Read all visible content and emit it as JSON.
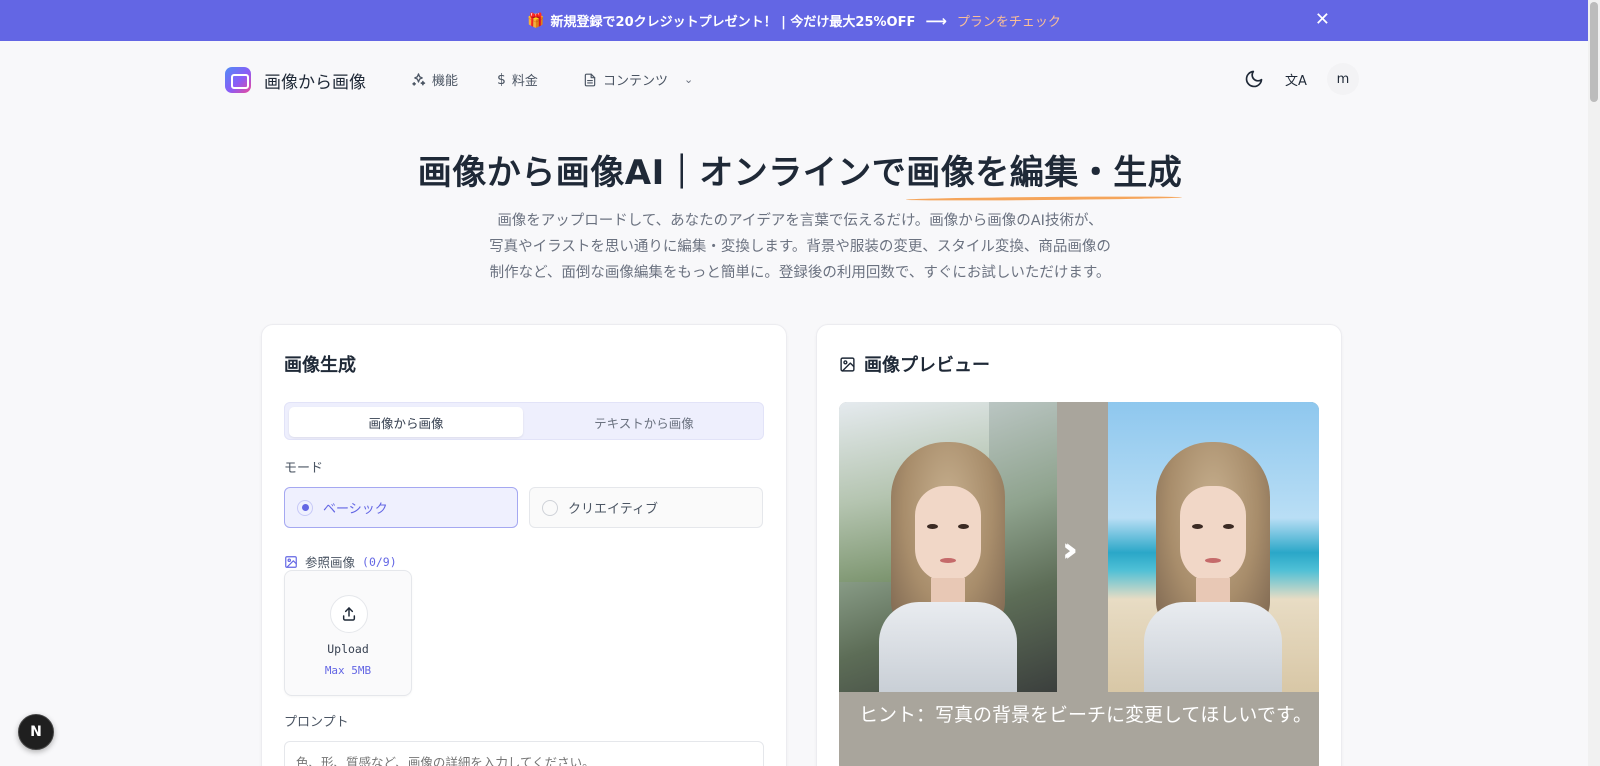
{
  "promo": {
    "text": "新規登録で20クレジットプレゼント！ | 今だけ最大25%OFF",
    "arrow": "⟶",
    "link": "プランをチェック",
    "close": "✕"
  },
  "nav": {
    "brand": "画像から画像",
    "items": [
      {
        "label": "機能",
        "icon": "sparkles-icon"
      },
      {
        "label": "料金",
        "icon": "dollar-icon"
      },
      {
        "label": "コンテンツ",
        "icon": "document-icon"
      }
    ],
    "avatar": "m"
  },
  "hero": {
    "title_plain": "画像から画像AI｜オンラインで",
    "title_highlight": "画像を編集・生成",
    "subtitle_lines": [
      "画像をアップロードして、あなたのアイデアを言葉で伝えるだけ。画像から画像のAI技術が、",
      "写真やイラストを思い通りに編集・変換します。背景や服装の変更、スタイル変換、商品画像の",
      "制作など、面倒な画像編集をもっと簡単に。登録後の利用回数で、すぐにお試しいただけます。"
    ]
  },
  "generator": {
    "title": "画像生成",
    "tabs": [
      {
        "label": "画像から画像",
        "active": true
      },
      {
        "label": "テキストから画像",
        "active": false
      }
    ],
    "mode_label": "モード",
    "modes": [
      {
        "label": "ベーシック",
        "selected": true
      },
      {
        "label": "クリエイティブ",
        "selected": false
      }
    ],
    "ref_label": "参照画像",
    "ref_count": "(0/9)",
    "upload_label": "Upload",
    "upload_max": "Max 5MB",
    "prompt_label": "プロンプト",
    "prompt_placeholder": "色、形、質感など、画像の詳細を入力してください。"
  },
  "preview": {
    "title": "画像プレビュー",
    "hint": "ヒント：写真の背景をビーチに変更してほしいです。"
  },
  "floating": {
    "label": "N"
  },
  "colors": {
    "accent": "#6366e4",
    "promo_link": "#fbbf96",
    "highlight_underline": "#f5a55b"
  }
}
